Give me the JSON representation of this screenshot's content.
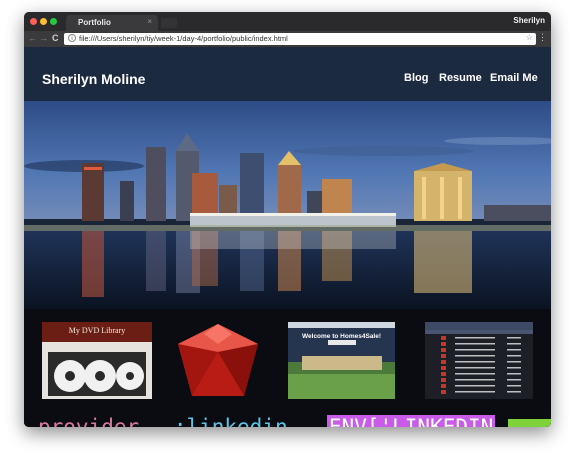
{
  "browser": {
    "tab_title": "Portfolio",
    "tab_close": "×",
    "profile_name": "Sherilyn",
    "url": "file:///Users/sherilyn/tiy/week-1/day-4/portfolio/public/index.html",
    "nav": {
      "back": "←",
      "forward": "→",
      "reload": "C"
    },
    "star": "☆",
    "menu": "⋮"
  },
  "site": {
    "brand": "Sherilyn Moline",
    "nav": [
      "Blog",
      "Resume",
      "Email Me"
    ]
  },
  "thumbnails": {
    "dvd_title": "My DVD Library",
    "homes_title": "Welcome to Homes4Sale!"
  },
  "code_strip": {
    "provider": "provider",
    "linkedin": ":linkedin,",
    "env": "ENV['LINKEDIN"
  },
  "colors": {
    "header_bg": "#1c2a40",
    "ruby_red": "#c0201a",
    "code_provider": "#d97a9a",
    "code_linkedin": "#5fc4e6",
    "code_env": "#c85ce8",
    "code_green": "#7fd23a"
  }
}
